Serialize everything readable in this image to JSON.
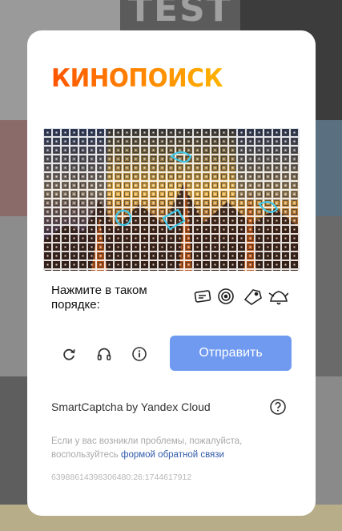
{
  "background": {
    "text": "TEST"
  },
  "logo": {
    "text": "КИНОПОИСК",
    "color_start": "#f50",
    "color_end": "#ffb300"
  },
  "captcha": {
    "image_alt": "captcha-image",
    "instruction": "Нажмите в таком порядке:",
    "order_icons": [
      "card-icon",
      "spiral-icon",
      "tag-icon",
      "bell-icon"
    ]
  },
  "controls": {
    "refresh_icon": "refresh-icon",
    "audio_icon": "headphones-icon",
    "info_icon": "info-icon",
    "submit_label": "Отправить",
    "submit_color": "#6f9af0"
  },
  "footer": {
    "brand": "SmartCaptcha by Yandex Cloud",
    "help_icon": "question-icon",
    "problem_text": "Если у вас возникли проблемы, пожалуйста, воспользуйтесь ",
    "feedback_link": "формой обратной связи",
    "request_id": "63988614398306480:26:1744617912"
  }
}
